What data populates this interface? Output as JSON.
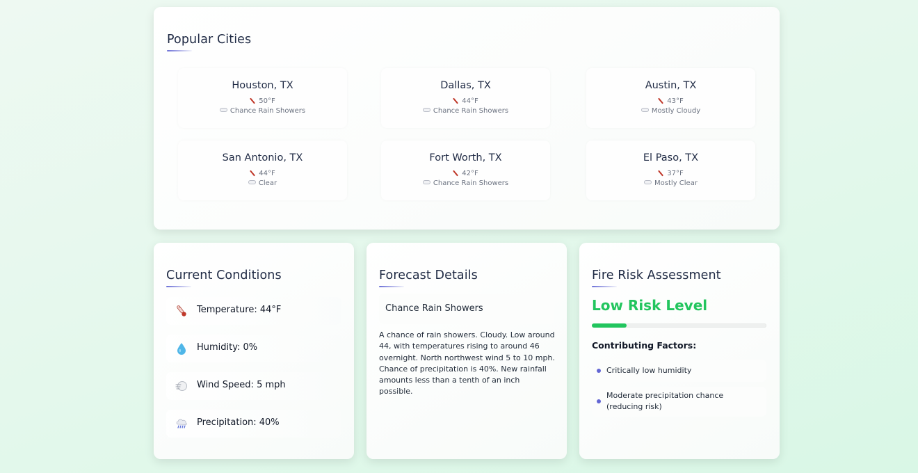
{
  "popular": {
    "title": "Popular Cities",
    "cities": [
      {
        "name": "Houston, TX",
        "temp": "50°F",
        "condition": "Chance Rain Showers"
      },
      {
        "name": "Dallas, TX",
        "temp": "44°F",
        "condition": "Chance Rain Showers"
      },
      {
        "name": "Austin, TX",
        "temp": "43°F",
        "condition": "Mostly Cloudy"
      },
      {
        "name": "San Antonio, TX",
        "temp": "44°F",
        "condition": "Clear"
      },
      {
        "name": "Fort Worth, TX",
        "temp": "42°F",
        "condition": "Chance Rain Showers"
      },
      {
        "name": "El Paso, TX",
        "temp": "37°F",
        "condition": "Mostly Clear"
      }
    ],
    "icons": {
      "temp": "thermometer-icon",
      "condition": "cloud-icon"
    }
  },
  "current": {
    "title": "Current Conditions",
    "rows": [
      {
        "icon": "thermometer-icon",
        "label": "Temperature: 44°F"
      },
      {
        "icon": "droplet-icon",
        "label": "Humidity: 0%"
      },
      {
        "icon": "wind-icon",
        "label": "Wind Speed: 5 mph"
      },
      {
        "icon": "rain-cloud-icon",
        "label": "Precipitation: 40%"
      }
    ]
  },
  "forecast": {
    "title": "Forecast Details",
    "short": "Chance Rain Showers",
    "detailed": "A chance of rain showers. Cloudy. Low around 44, with temperatures rising to around 46 overnight. North northwest wind 5 to 10 mph. Chance of precipitation is 40%. New rainfall amounts less than a tenth of an inch possible."
  },
  "risk": {
    "title": "Fire Risk Assessment",
    "level": "Low Risk Level",
    "level_fraction": 0.2,
    "level_color": "#22c55e",
    "factors_title": "Contributing Factors:",
    "factors": [
      "Critically low humidity",
      "Moderate precipitation chance (reducing risk)"
    ]
  },
  "colors": {
    "accent": "#6b6fd6",
    "risk_low": "#22c55e",
    "background": "#e4f8ec"
  }
}
